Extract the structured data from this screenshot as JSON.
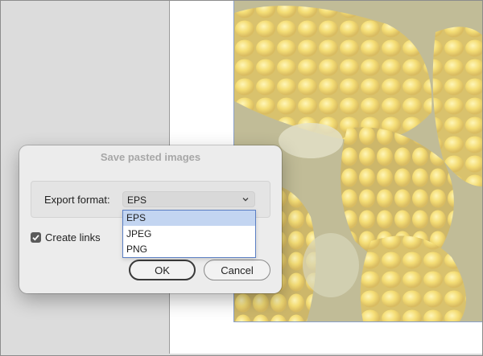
{
  "dialog": {
    "title": "Save pasted images",
    "export_format_label": "Export format:",
    "export_format_value": "EPS",
    "export_format_options": [
      "EPS",
      "JPEG",
      "PNG"
    ],
    "create_links_label": "Create links",
    "create_links_checked": true,
    "ok_label": "OK",
    "cancel_label": "Cancel"
  },
  "colors": {
    "selection_highlight": "#c3d5f1",
    "dropdown_border": "#5b7fc4",
    "dialog_background": "#ececec"
  },
  "icons": [
    "chevron-down-icon",
    "check-icon"
  ]
}
